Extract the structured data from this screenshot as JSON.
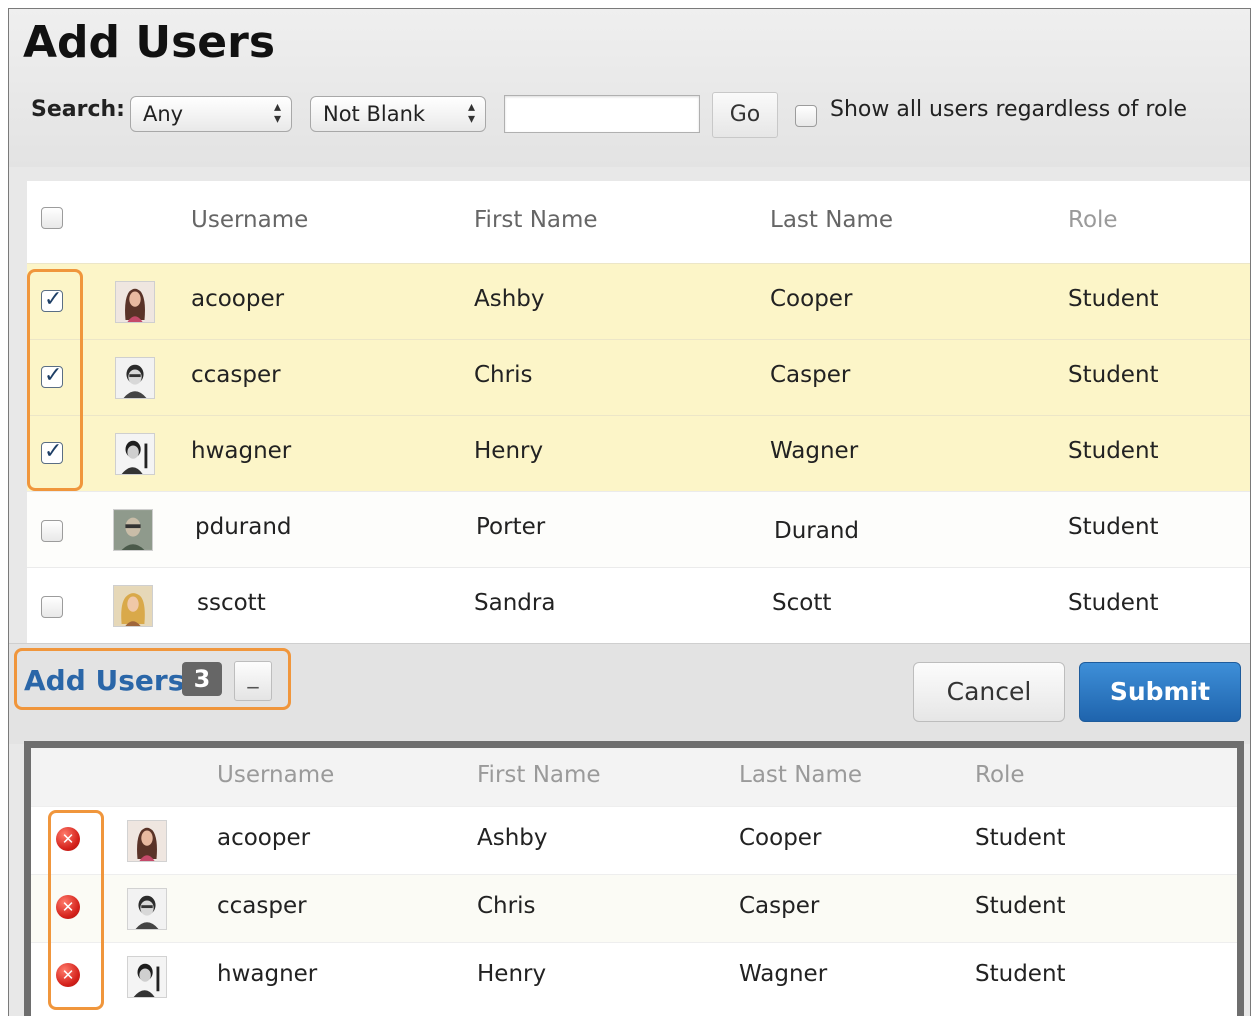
{
  "page": {
    "title": "Add Users"
  },
  "search": {
    "label": "Search:",
    "field_select": "Any",
    "operator_select": "Not Blank",
    "query_value": "",
    "go_label": "Go",
    "show_all_label": "Show all users regardless of role",
    "show_all_checked": false
  },
  "table": {
    "columns": [
      "Username",
      "First Name",
      "Last Name",
      "Role"
    ],
    "rows": [
      {
        "username": "acooper",
        "first_name": "Ashby",
        "last_name": "Cooper",
        "role": "Student",
        "checked": true,
        "avatar": "woman-long-hair-avatar"
      },
      {
        "username": "ccasper",
        "first_name": "Chris",
        "last_name": "Casper",
        "role": "Student",
        "checked": true,
        "avatar": "man-avatar"
      },
      {
        "username": "hwagner",
        "first_name": "Henry",
        "last_name": "Wagner",
        "role": "Student",
        "checked": true,
        "avatar": "man-bw-avatar"
      },
      {
        "username": "pdurand",
        "first_name": "Porter",
        "last_name": "Durand",
        "role": "Student",
        "checked": false,
        "avatar": "man-glasses-avatar"
      },
      {
        "username": "sscott",
        "first_name": "Sandra",
        "last_name": "Scott",
        "role": "Student",
        "checked": false,
        "avatar": "woman-blonde-avatar"
      }
    ]
  },
  "footer": {
    "add_users_label": "Add Users",
    "selected_count": "3",
    "collapse_label": "_",
    "cancel_label": "Cancel",
    "submit_label": "Submit"
  },
  "selected_panel": {
    "columns": [
      "Username",
      "First Name",
      "Last Name",
      "Role"
    ],
    "rows": [
      {
        "username": "acooper",
        "first_name": "Ashby",
        "last_name": "Cooper",
        "role": "Student"
      },
      {
        "username": "ccasper",
        "first_name": "Chris",
        "last_name": "Casper",
        "role": "Student"
      },
      {
        "username": "hwagner",
        "first_name": "Henry",
        "last_name": "Wagner",
        "role": "Student"
      }
    ]
  },
  "colors": {
    "highlight": "#f0963c",
    "selected_row": "#fcf5c8",
    "submit": "#2a72bc",
    "link": "#2a66a8",
    "remove_icon": "#d3201a"
  }
}
